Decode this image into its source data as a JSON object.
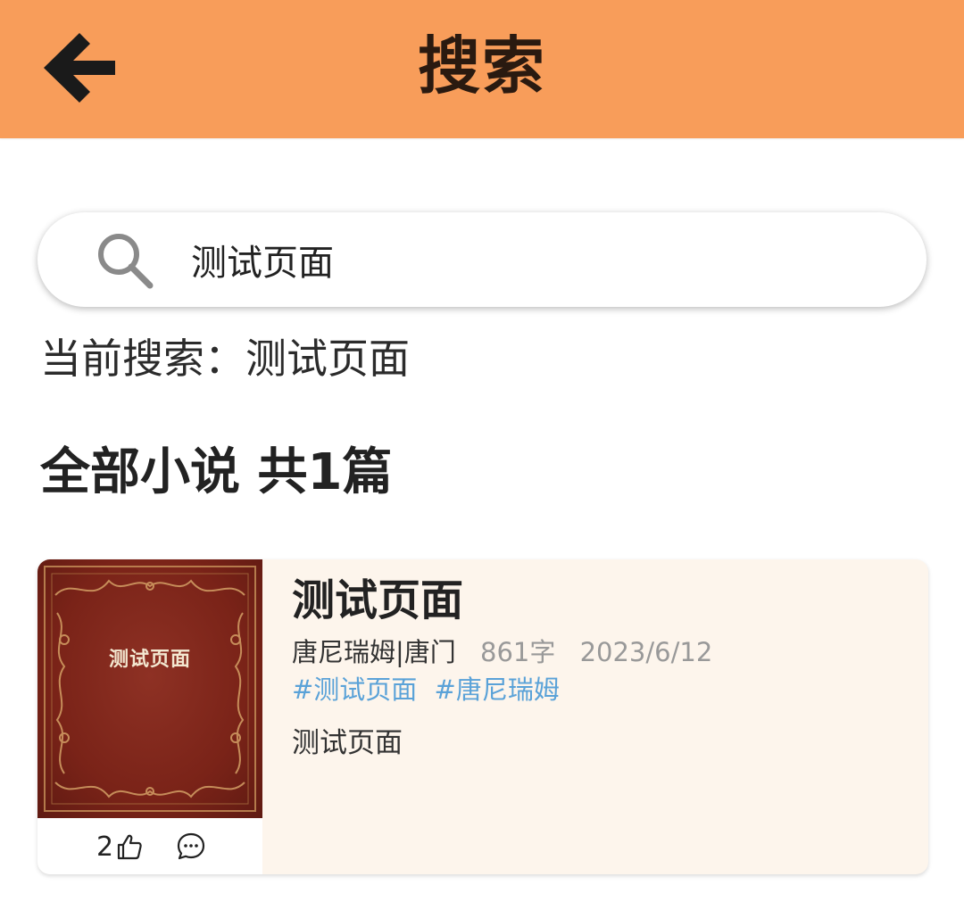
{
  "header": {
    "title": "搜索",
    "back_icon": "arrow-left-icon",
    "background_color": "#f89d5a"
  },
  "search": {
    "value": "测试页面",
    "icon": "search-icon"
  },
  "current_search": {
    "text": "当前搜索：测试页面"
  },
  "section": {
    "title": "全部小说 共1篇"
  },
  "results": [
    {
      "title": "测试页面",
      "cover_title": "测试页面",
      "author": "唐尼瑞姆|唐门",
      "word_count": "861字",
      "date": "2023/6/12",
      "tags": [
        "#测试页面",
        "#唐尼瑞姆"
      ],
      "summary": "测试页面",
      "likes": "2",
      "like_icon": "thumbs-up-icon",
      "comment_icon": "comment-icon"
    }
  ],
  "colors": {
    "accent": "#f89d5a",
    "tag": "#5aa2d8",
    "card_bg": "#fdf5ec",
    "cover": "#7a2318"
  }
}
